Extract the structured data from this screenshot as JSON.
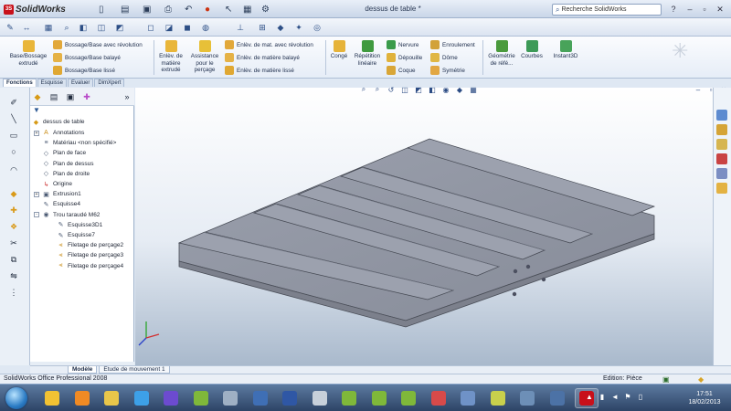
{
  "app": {
    "logo_text": "SolidWorks",
    "doc_title": "dessus de table *"
  },
  "search": {
    "placeholder": "Recherche SolidWorks"
  },
  "titlebar": {
    "icons": [
      "new-icon",
      "open-icon",
      "save-icon",
      "print-icon",
      "undo-icon",
      "traffic-light-icon",
      "select-icon",
      "rebuild-icon",
      "options-icon"
    ],
    "help": "?",
    "win": [
      "minimize-icon",
      "restore-icon",
      "close-icon"
    ]
  },
  "command_manager": {
    "big": [
      {
        "label": "Base/Bossage extrudé",
        "icon": "extruded-boss-icon"
      },
      {
        "label": "Enlèv. de matière extrudé",
        "icon": "extruded-cut-icon"
      },
      {
        "label": "Assistance pour le perçage",
        "icon": "hole-wizard-icon"
      },
      {
        "label": "Congé",
        "icon": "fillet-icon"
      },
      {
        "label": "Répétition linéaire",
        "icon": "linear-pattern-icon"
      },
      {
        "label": "Géométrie de réfé...",
        "icon": "reference-geometry-icon"
      },
      {
        "label": "Courbes",
        "icon": "curves-icon"
      },
      {
        "label": "Instant3D",
        "icon": "instant3d-icon"
      }
    ],
    "col1": [
      "Bossage/Base avec révolution",
      "Bossage/Base balayé",
      "Bossage/Base lissé"
    ],
    "col2": [
      "Enlèv. de mat. avec révolution",
      "Enlèv. de matière balayé",
      "Enlèv. de matière lissé"
    ],
    "col3": [
      "Nervure",
      "Dépouille",
      "Coque"
    ],
    "col4": [
      "Enroulement",
      "Dôme",
      "Symétrie"
    ]
  },
  "tabs": [
    "Fonctions",
    "Esquisse",
    "Evaluer",
    "DimXpert"
  ],
  "tree": {
    "root": "dessus de table",
    "items": [
      {
        "label": "Annotations",
        "icon": "annotations-icon",
        "expand": "+"
      },
      {
        "label": "Matériau <non spécifié>",
        "icon": "material-icon",
        "expand": ""
      },
      {
        "label": "Plan de face",
        "icon": "plane-icon",
        "expand": ""
      },
      {
        "label": "Plan de dessus",
        "icon": "plane-icon",
        "expand": ""
      },
      {
        "label": "Plan de droite",
        "icon": "plane-icon",
        "expand": ""
      },
      {
        "label": "Origine",
        "icon": "origin-icon",
        "expand": ""
      },
      {
        "label": "Extrusion1",
        "icon": "extrude-icon",
        "expand": "+"
      },
      {
        "label": "Esquisse4",
        "icon": "sketch-icon",
        "expand": ""
      },
      {
        "label": "Trou taraudé M62",
        "icon": "hole-icon",
        "expand": "-"
      },
      {
        "label": "Esquisse3D1",
        "icon": "sketch3d-icon",
        "expand": ""
      },
      {
        "label": "Esquisse7",
        "icon": "sketch-icon",
        "expand": ""
      },
      {
        "label": "Filetage de perçage2",
        "icon": "thread-icon",
        "expand": ""
      },
      {
        "label": "Filetage de perçage3",
        "icon": "thread-icon",
        "expand": ""
      },
      {
        "label": "Filetage de perçage4",
        "icon": "thread-icon",
        "expand": ""
      }
    ]
  },
  "bottom_tabs": [
    "Modèle",
    "Etude de mouvement 1"
  ],
  "status": {
    "left": "SolidWorks Office Professional 2008",
    "mode": "Edition: Pièce"
  },
  "taskbar": {
    "apps": [
      "explorer",
      "media-player",
      "file-manager",
      "internet-explorer",
      "nvu",
      "messenger",
      "weather",
      "thunderbird",
      "word",
      "calculator",
      "messenger2",
      "messenger3",
      "messenger4",
      "paint",
      "presentation",
      "internet",
      "settings",
      "browser",
      "solidworks"
    ],
    "time": "17:51",
    "date": "18/02/2013"
  },
  "colors": {
    "accent": "#c8101a",
    "model": "#8d92a0",
    "panel": "#eaf0f7"
  }
}
